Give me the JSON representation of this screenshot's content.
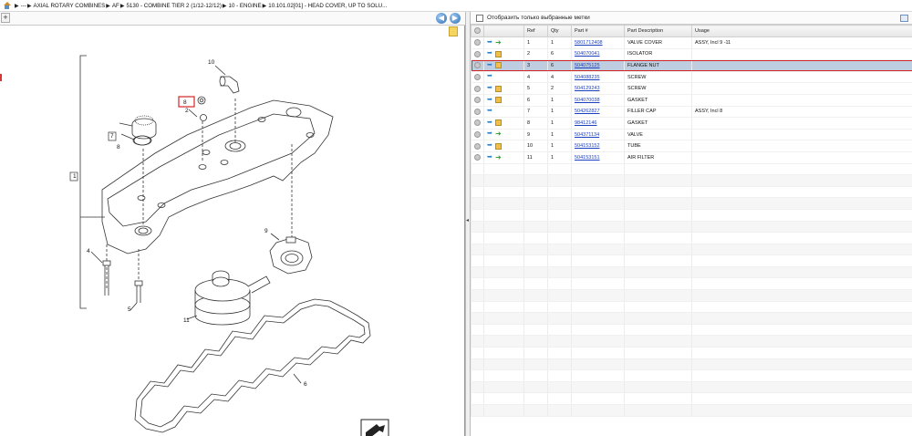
{
  "breadcrumb": {
    "items": [
      "---",
      "AXIAL ROTARY COMBINES",
      "AF",
      "5130 - COMBINE TIER 2 (1/12-12/12)",
      "10 - ENGINE",
      "10.101.02[01] - HEAD COVER, UP TO SOLU..."
    ]
  },
  "left_toolbar": {
    "plus": "+"
  },
  "drawing": {
    "callouts": [
      "10",
      "8",
      "2",
      "7",
      "8",
      "1",
      "9",
      "4",
      "5",
      "11",
      "6"
    ]
  },
  "filter": {
    "label": "Отобразить только выбранные метки"
  },
  "table": {
    "headers": {
      "ref": "Ref",
      "qty": "Qty",
      "part": "Part #",
      "desc": "Part Description",
      "usage": "Usage"
    },
    "rows": [
      {
        "ref": "1",
        "qty": "1",
        "part": "5801712408",
        "desc": "VALVE COVER",
        "usage": "ASSY, Incl 9 -11",
        "icon": "green-arrow"
      },
      {
        "ref": "2",
        "qty": "6",
        "part": "504070041",
        "desc": "ISOLATOR",
        "usage": "",
        "icon": "box"
      },
      {
        "ref": "3",
        "qty": "6",
        "part": "504075125",
        "desc": "FLANGE NUT",
        "usage": "",
        "icon": "box",
        "selected": true
      },
      {
        "ref": "4",
        "qty": "4",
        "part": "504088235",
        "desc": "SCREW",
        "usage": "",
        "icon": "none"
      },
      {
        "ref": "5",
        "qty": "2",
        "part": "504129243",
        "desc": "SCREW",
        "usage": "",
        "icon": "box"
      },
      {
        "ref": "6",
        "qty": "1",
        "part": "504070038",
        "desc": "GASKET",
        "usage": "",
        "icon": "box"
      },
      {
        "ref": "7",
        "qty": "1",
        "part": "504262827",
        "desc": "FILLER CAP",
        "usage": "ASSY, Incl 8",
        "icon": "none"
      },
      {
        "ref": "8",
        "qty": "1",
        "part": "98412146",
        "desc": "GASKET",
        "usage": "",
        "icon": "box"
      },
      {
        "ref": "9",
        "qty": "1",
        "part": "504371134",
        "desc": "VALVE",
        "usage": "",
        "icon": "green-arrow"
      },
      {
        "ref": "10",
        "qty": "1",
        "part": "504153152",
        "desc": "TUBE",
        "usage": "",
        "icon": "box"
      },
      {
        "ref": "11",
        "qty": "1",
        "part": "504153151",
        "desc": "AIR FILTER",
        "usage": "",
        "icon": "green-arrow"
      }
    ]
  },
  "colors": {
    "selection_outline": "#d42525",
    "selection_fill": "#bfcde0",
    "link": "#1a3fbf"
  }
}
